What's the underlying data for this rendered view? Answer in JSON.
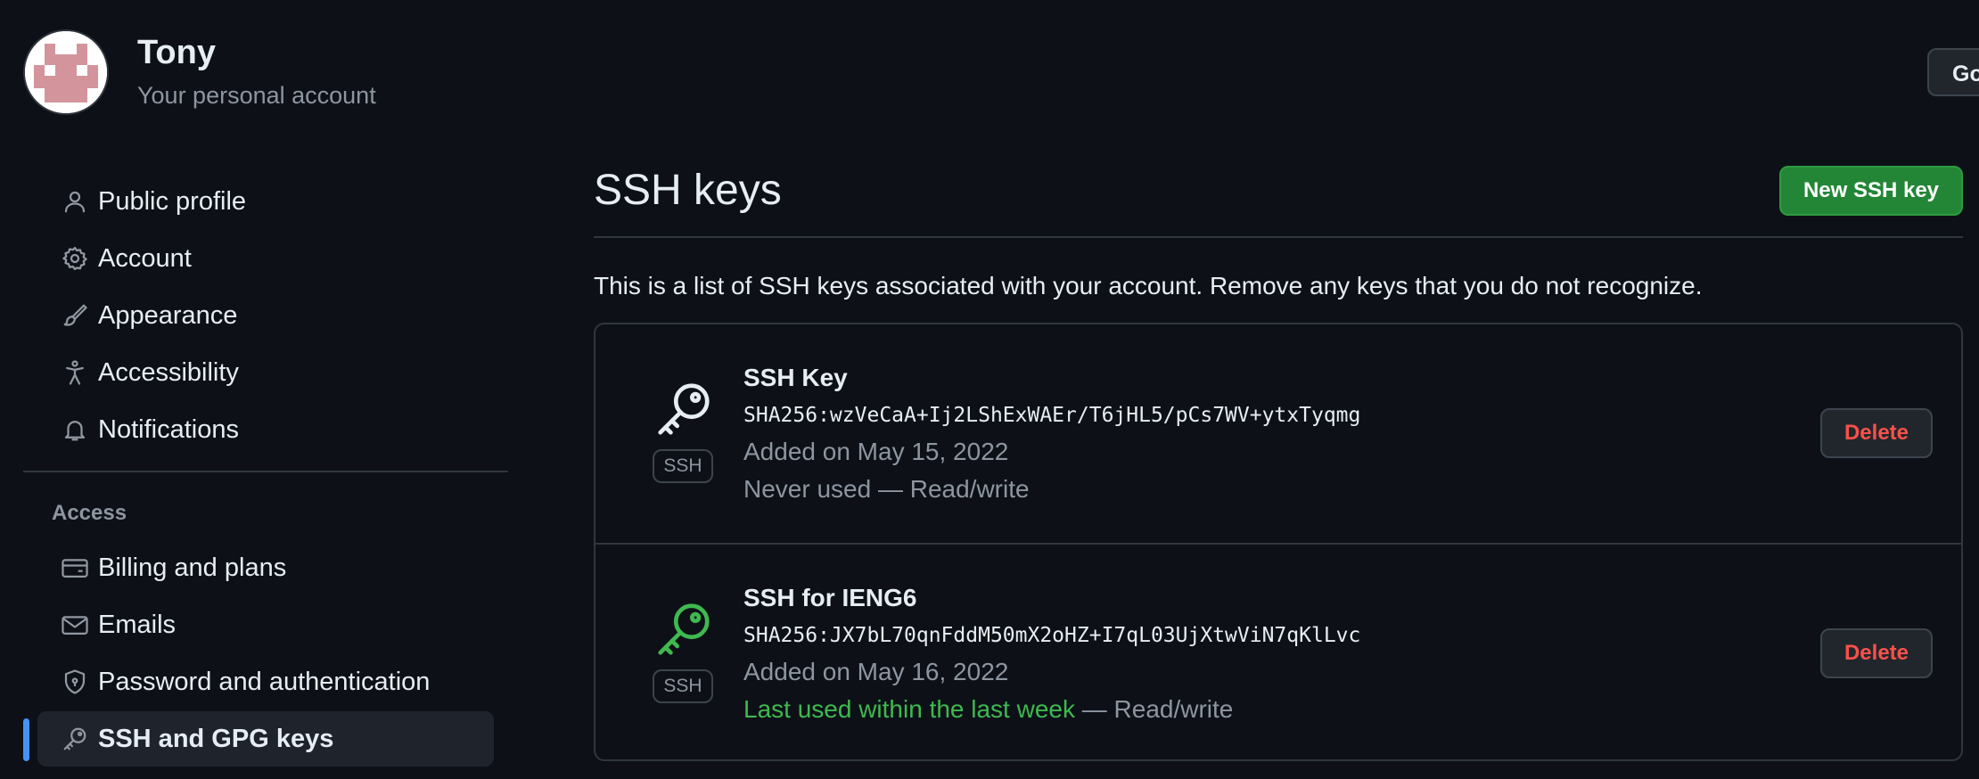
{
  "header": {
    "account_name": "Tony",
    "account_subtitle": "Your personal account",
    "goto_button_label": "Go"
  },
  "sidebar": {
    "items": [
      {
        "label": "Public profile",
        "icon": "person-icon"
      },
      {
        "label": "Account",
        "icon": "gear-icon"
      },
      {
        "label": "Appearance",
        "icon": "paintbrush-icon"
      },
      {
        "label": "Accessibility",
        "icon": "accessibility-icon"
      },
      {
        "label": "Notifications",
        "icon": "bell-icon"
      }
    ],
    "access_heading": "Access",
    "access_items": [
      {
        "label": "Billing and plans",
        "icon": "credit-card-icon"
      },
      {
        "label": "Emails",
        "icon": "mail-icon"
      },
      {
        "label": "Password and authentication",
        "icon": "shield-icon"
      },
      {
        "label": "SSH and GPG keys",
        "icon": "key-icon",
        "active": true
      }
    ]
  },
  "main": {
    "title": "SSH keys",
    "new_key_button": "New SSH key",
    "description": "This is a list of SSH keys associated with your account. Remove any keys that you do not recognize.",
    "keys": [
      {
        "title": "SSH Key",
        "badge": "SSH",
        "fingerprint": "SHA256:wzVeCaA+Ij2LShExWAEr/T6jHL5/pCs7WV+ytxTyqmg",
        "added": "Added on May 15, 2022",
        "usage": "Never used",
        "access": " — Read/write",
        "delete_label": "Delete",
        "icon_color": "#e6edf3"
      },
      {
        "title": "SSH for IENG6",
        "badge": "SSH",
        "fingerprint": "SHA256:JX7bL70qnFddM50mX2oHZ+I7qL03UjXtwViN7qKlLvc",
        "added": "Added on May 16, 2022",
        "usage": "Last used within the last week",
        "access": " — Read/write",
        "delete_label": "Delete",
        "icon_color": "#3fb950"
      }
    ]
  },
  "colors": {
    "background": "#0d1117",
    "primary_button": "#238636",
    "danger": "#f85149",
    "active_accent": "#4493f8",
    "recent_usage": "#3fb950"
  }
}
